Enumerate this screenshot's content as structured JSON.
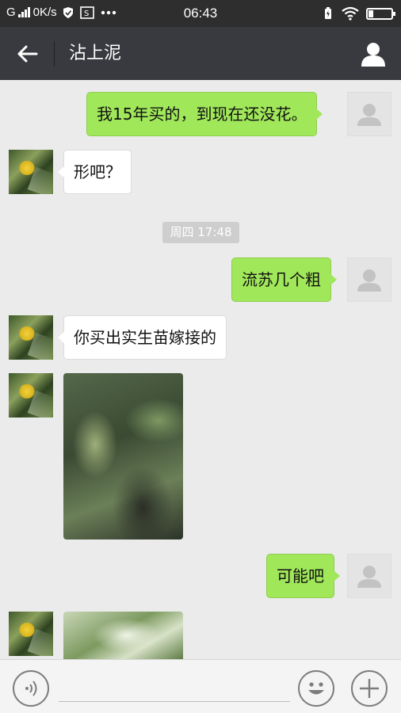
{
  "status_bar": {
    "network": "G",
    "speed": "0K/s",
    "time": "06:43"
  },
  "header": {
    "title": "沾上泥"
  },
  "messages": [
    {
      "side": "right",
      "text": "我15年买的，到现在还没花。"
    },
    {
      "side": "left",
      "text": "形吧？"
    },
    {
      "side": "timestamp",
      "text": "周四 17:48"
    },
    {
      "side": "right",
      "text": "流苏几个粗"
    },
    {
      "side": "left",
      "text": "你买出实生苗嫁接的"
    },
    {
      "side": "left",
      "type": "image"
    },
    {
      "side": "right",
      "text": "可能吧"
    },
    {
      "side": "left",
      "type": "image"
    }
  ],
  "icons": {
    "back": "arrow-left-icon",
    "profile": "person-icon",
    "voice": "voice-icon",
    "emoji": "smiley-icon",
    "more": "plus-icon"
  },
  "colors": {
    "outgoing_bubble": "#a0e75a",
    "incoming_bubble": "#ffffff",
    "header_bg": "#393a3f",
    "status_bar_bg": "#2e2e2e",
    "chat_bg": "#ebebeb"
  }
}
